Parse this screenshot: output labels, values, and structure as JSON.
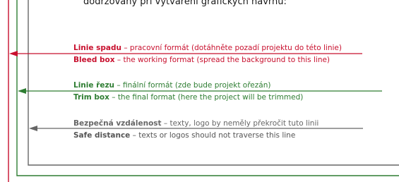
{
  "top_text": "dodržovány při vytváření grafických návrhů:",
  "colors": {
    "bleed": "#c8102e",
    "trim": "#2e7d32",
    "safe": "#666666"
  },
  "bleed": {
    "cz_term": "Linie spadu",
    "cz_desc": " – pracovní formát (dotáhněte pozadí projektu do této linie)",
    "en_term": "Bleed box",
    "en_desc": " – the working format (spread the background to this line)"
  },
  "trim": {
    "cz_term": "Linie řezu",
    "cz_desc": " – finální formát (zde bude projekt ořezán)",
    "en_term": "Trim box",
    "en_desc": " – the final format (here the project will be trimmed)"
  },
  "safe": {
    "cz_term": "Bezpečná vzdálenost",
    "cz_desc": " – texty, logo by neměly překročit tuto linii",
    "en_term": "Safe distance",
    "en_desc": " – texts or logos should not traverse this line"
  }
}
